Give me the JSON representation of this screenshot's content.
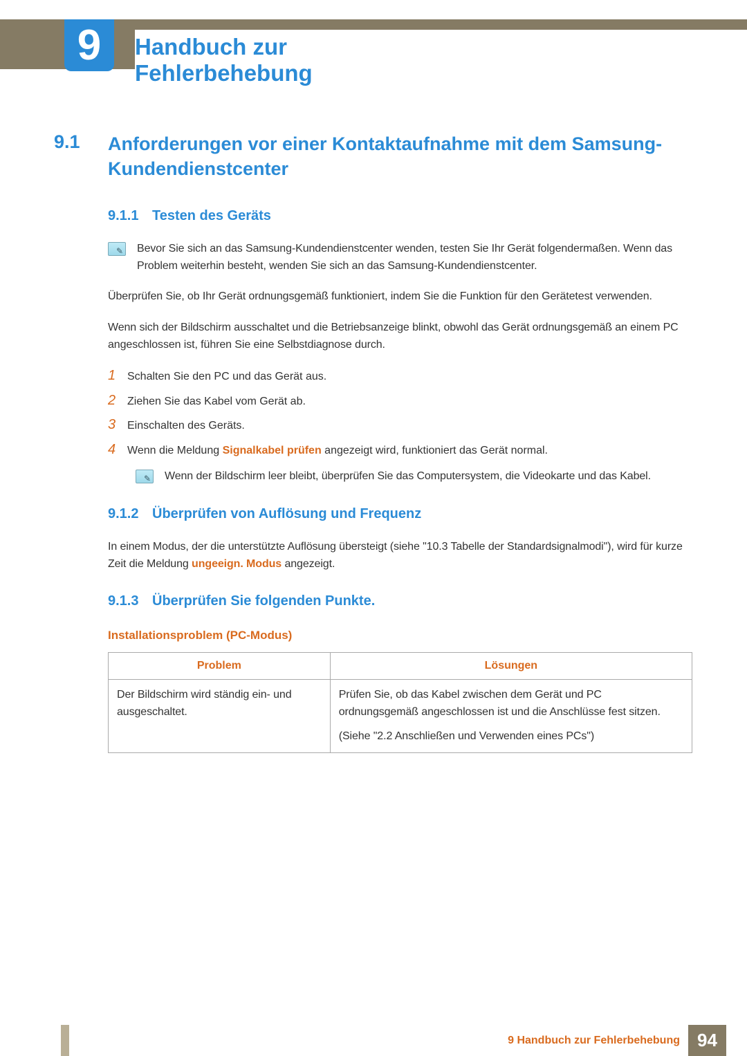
{
  "chapter": {
    "number": "9",
    "title": "Handbuch zur Fehlerbehebung"
  },
  "section": {
    "number": "9.1",
    "title": "Anforderungen vor einer Kontaktaufnahme mit dem Samsung-Kundendienstcenter"
  },
  "sub1": {
    "number": "9.1.1",
    "title": "Testen des Geräts",
    "note": "Bevor Sie sich an das Samsung-Kundendienstcenter wenden, testen Sie Ihr Gerät folgendermaßen. Wenn das Problem weiterhin besteht, wenden Sie sich an das Samsung-Kundendienstcenter.",
    "p1": "Überprüfen Sie, ob Ihr Gerät ordnungsgemäß funktioniert, indem Sie die Funktion für den Gerätetest verwenden.",
    "p2": "Wenn sich der Bildschirm ausschaltet und die Betriebsanzeige blinkt, obwohl das Gerät ordnungsgemäß an einem PC angeschlossen ist, führen Sie eine Selbstdiagnose durch.",
    "steps": [
      "Schalten Sie den PC und das Gerät aus.",
      "Ziehen Sie das Kabel vom Gerät ab.",
      "Einschalten des Geräts."
    ],
    "step4_prefix": "Wenn die Meldung ",
    "step4_bold": "Signalkabel prüfen",
    "step4_suffix": " angezeigt wird, funktioniert das Gerät normal.",
    "note2": "Wenn der Bildschirm leer bleibt, überprüfen Sie das Computersystem, die Videokarte und das Kabel."
  },
  "sub2": {
    "number": "9.1.2",
    "title": "Überprüfen von Auflösung und Frequenz",
    "p_prefix": "In einem Modus, der die unterstützte Auflösung übersteigt (siehe \"10.3 Tabelle der Standardsignalmodi\"), wird für kurze Zeit die Meldung ",
    "p_bold": "ungeeign. Modus",
    "p_suffix": " angezeigt."
  },
  "sub3": {
    "number": "9.1.3",
    "title": "Überprüfen Sie folgenden Punkte.",
    "h3": "Installationsproblem (PC-Modus)",
    "th_problem": "Problem",
    "th_solution": "Lösungen",
    "row1": {
      "problem": "Der Bildschirm wird ständig ein- und ausgeschaltet.",
      "sol1": "Prüfen Sie, ob das Kabel zwischen dem Gerät und PC ordnungsgemäß angeschlossen ist und die Anschlüsse fest sitzen.",
      "sol2": "(Siehe \"2.2 Anschließen und Verwenden eines PCs\")"
    }
  },
  "footer": {
    "label": "9 Handbuch zur Fehlerbehebung",
    "page": "94"
  }
}
